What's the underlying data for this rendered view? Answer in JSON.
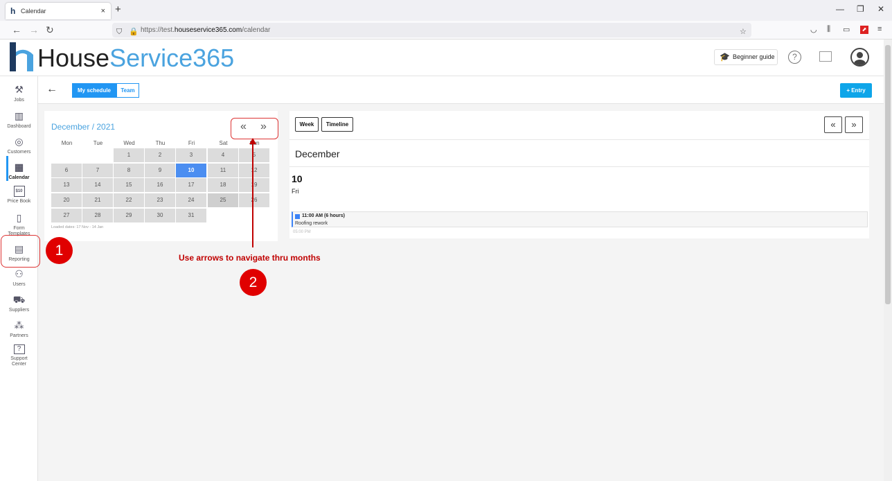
{
  "browser": {
    "tab_title": "Calendar",
    "tab_close": "×",
    "new_tab": "+",
    "url_prefix": "https://test.",
    "url_host": "houseservice365.com",
    "url_path": "/calendar"
  },
  "header": {
    "logo_part1": "House",
    "logo_part2": "Service365",
    "beginner_guide": "Beginner guide",
    "help": "?"
  },
  "sidebar": {
    "items": [
      {
        "label": "Jobs",
        "icon": "tools-icon"
      },
      {
        "label": "Dashboard",
        "icon": "chart-icon"
      },
      {
        "label": "Customers",
        "icon": "customers-icon"
      },
      {
        "label": "Calendar",
        "icon": "calendar-icon"
      },
      {
        "label": "Price Book",
        "icon": "price-book-icon",
        "badge": "$10"
      },
      {
        "label": "Form Templates",
        "icon": "form-icon"
      },
      {
        "label": "Reporting",
        "icon": "report-icon"
      },
      {
        "label": "Users",
        "icon": "users-icon"
      },
      {
        "label": "Suppliers",
        "icon": "truck-icon"
      },
      {
        "label": "Partners",
        "icon": "partners-icon"
      },
      {
        "label": "Support Center",
        "icon": "support-icon"
      }
    ]
  },
  "toolbar": {
    "my_schedule": "My schedule",
    "team": "Team",
    "entry": "+ Entry"
  },
  "mini_calendar": {
    "title": "December / 2021",
    "prev": "«",
    "next": "»",
    "weekdays": [
      "Mon",
      "Tue",
      "Wed",
      "Thu",
      "Fri",
      "Sat",
      "Sun"
    ],
    "weeks": [
      [
        "",
        "",
        "1",
        "2",
        "3",
        "4",
        "5"
      ],
      [
        "6",
        "7",
        "8",
        "9",
        "10",
        "11",
        "12"
      ],
      [
        "13",
        "14",
        "15",
        "16",
        "17",
        "18",
        "19"
      ],
      [
        "20",
        "21",
        "22",
        "23",
        "24",
        "25",
        "26"
      ],
      [
        "27",
        "28",
        "29",
        "30",
        "31",
        "",
        ""
      ]
    ],
    "today": "10",
    "selected": "25",
    "loaded_dates": "Loaded dates: 17 Nov - 14 Jan"
  },
  "schedule": {
    "week": "Week",
    "timeline": "Timeline",
    "prev": "«",
    "next": "»",
    "month": "December",
    "day_number": "10",
    "day_name": "Fri",
    "event_time": "11:00 AM (6 hours)",
    "event_title": "Roofing rework",
    "event_end": "05:00 PM"
  },
  "annotations": {
    "badge1": "1",
    "badge2": "2",
    "instruction": "Use arrows to navigate thru months"
  }
}
